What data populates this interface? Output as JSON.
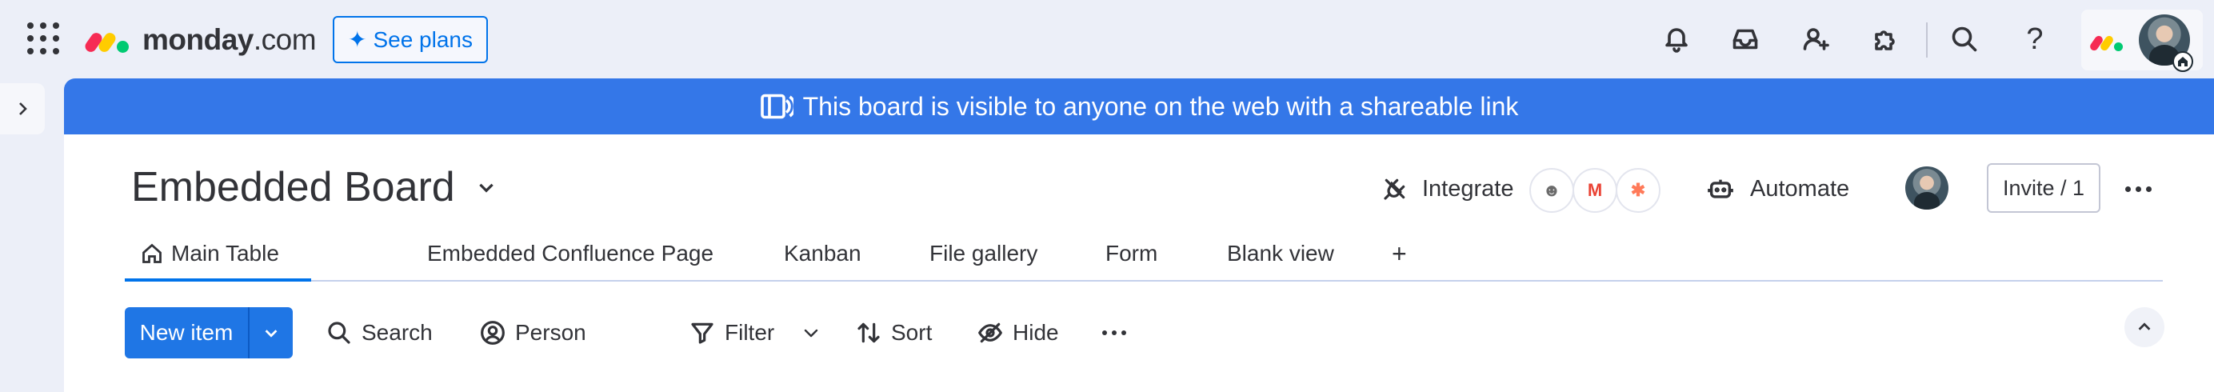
{
  "topbar": {
    "logo_text": "monday",
    "logo_suffix": ".com",
    "see_plans_label": "See plans",
    "icons": [
      "apps-grid-icon",
      "bell-icon",
      "inbox-icon",
      "invite-person-icon",
      "puzzle-icon",
      "search-icon",
      "help-icon"
    ]
  },
  "banner": {
    "text": "This board is visible to anyone on the web with a shareable link"
  },
  "board": {
    "title": "Embedded Board",
    "integrate_label": "Integrate",
    "integrations": [
      "mailchimp",
      "gmail",
      "hubspot"
    ],
    "automate_label": "Automate",
    "invite_label": "Invite / 1"
  },
  "tabs": [
    {
      "label": "Main Table",
      "active": true
    },
    {
      "label": "Embedded Confluence Page",
      "active": false
    },
    {
      "label": "Kanban",
      "active": false
    },
    {
      "label": "File gallery",
      "active": false
    },
    {
      "label": "Form",
      "active": false
    },
    {
      "label": "Blank view",
      "active": false
    },
    {
      "label": "+",
      "active": false
    }
  ],
  "toolbar": {
    "new_item_label": "New item",
    "search_label": "Search",
    "person_label": "Person",
    "filter_label": "Filter",
    "sort_label": "Sort",
    "hide_label": "Hide"
  },
  "colors": {
    "brand_blue": "#0073ea",
    "banner_blue": "#3477e8",
    "logo_red": "#f62b54",
    "logo_yellow": "#ffcc00",
    "logo_green": "#00ca72"
  }
}
